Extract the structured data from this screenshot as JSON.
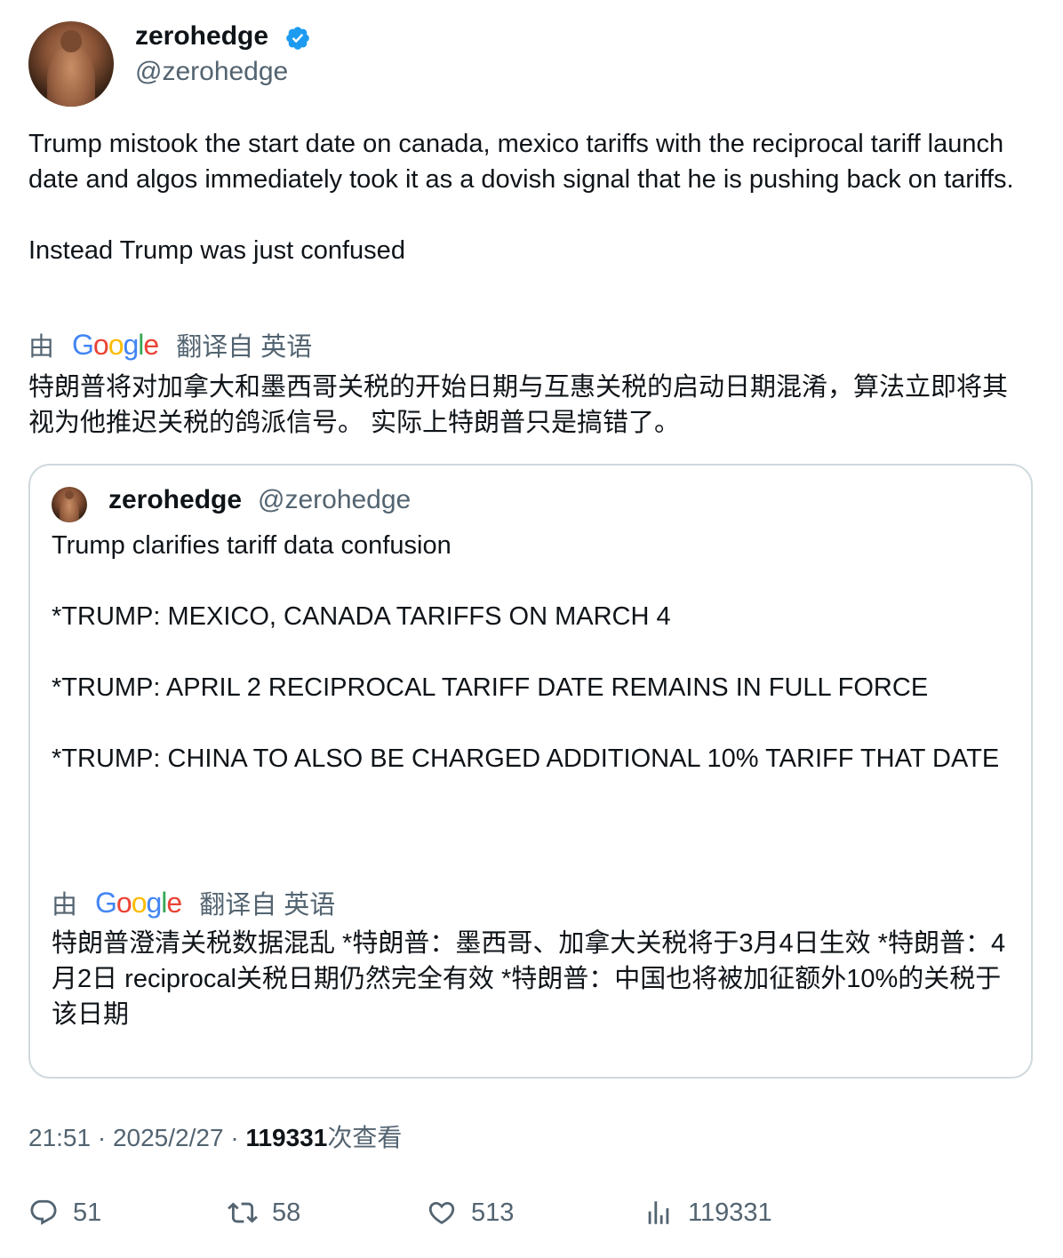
{
  "author": {
    "display_name": "zerohedge",
    "handle": "@zerohedge",
    "verified_color": "#1d9bf0"
  },
  "tweet": {
    "text": "Trump mistook the start date on canada, mexico tariffs with the reciprocal tariff launch date and algos immediately took it as a dovish signal that he is pushing back on tariffs.\n\nInstead Trump was just confused",
    "translation_prefix": "由",
    "translation_suffix": "翻译自 英语",
    "translation": "特朗普将对加拿大和墨西哥关税的开始日期与互惠关税的启动日期混淆，算法立即将其视为他推迟关税的鸽派信号。 实际上特朗普只是搞错了。"
  },
  "quote": {
    "display_name": "zerohedge",
    "handle": "@zerohedge",
    "text": "Trump clarifies tariff data confusion\n\n*TRUMP: MEXICO, CANADA TARIFFS ON MARCH 4\n\n*TRUMP: APRIL 2 RECIPROCAL TARIFF DATE REMAINS IN FULL FORCE\n\n*TRUMP: CHINA TO ALSO BE CHARGED ADDITIONAL 10% TARIFF THAT DATE",
    "translation_prefix": "由",
    "translation_suffix": "翻译自 英语",
    "translation": "特朗普澄清关税数据混乱 *特朗普：墨西哥、加拿大关税将于3月4日生效 *特朗普：4月2日 reciprocal关税日期仍然完全有效 *特朗普：中国也将被加征额外10%的关税于该日期"
  },
  "meta": {
    "time": "21:51",
    "date": "2025/2/27",
    "separator": "·",
    "views": "119331",
    "views_label": "次查看"
  },
  "actions": {
    "replies": "51",
    "retweets": "58",
    "likes": "513",
    "views": "119331"
  }
}
